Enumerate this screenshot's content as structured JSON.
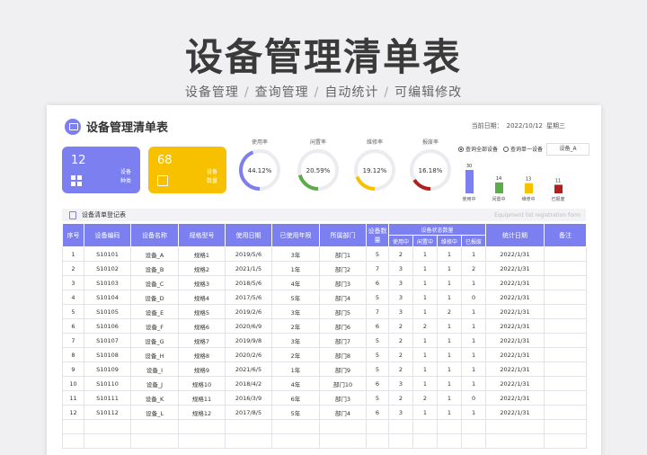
{
  "hero": {
    "title": "设备管理清单表",
    "subtitle": [
      "设备管理",
      "查询管理",
      "自动统计",
      "可编辑修改"
    ]
  },
  "sheet": {
    "title": "设备管理清单表",
    "date_label": "当前日期：",
    "date_value": "2022/10/12",
    "weekday": "星期三"
  },
  "kpis": [
    {
      "value": "12",
      "label": "设备种类",
      "color": "#7b7ff0",
      "icon": "grid-icon"
    },
    {
      "value": "68",
      "label": "设备数量",
      "color": "#f8c100",
      "icon": "calendar-icon"
    }
  ],
  "gauges": [
    {
      "label": "使用率",
      "value": "44.12%",
      "fraction": 0.4412,
      "color": "#7b7ff0"
    },
    {
      "label": "闲置率",
      "value": "20.59%",
      "fraction": 0.2059,
      "color": "#5cac4b"
    },
    {
      "label": "维修率",
      "value": "19.12%",
      "fraction": 0.1912,
      "color": "#f8c100"
    },
    {
      "label": "报废率",
      "value": "16.18%",
      "fraction": 0.1618,
      "color": "#b21f1f"
    }
  ],
  "query": {
    "options": [
      "查询全部设备",
      "查询单一设备"
    ],
    "selected": 0,
    "select_value": "设备_A"
  },
  "mini_bars": [
    {
      "label": "使用中",
      "value": 30,
      "color": "#7b7ff0"
    },
    {
      "label": "闲置中",
      "value": 14,
      "color": "#5cac4b"
    },
    {
      "label": "维修中",
      "value": 13,
      "color": "#f8c100"
    },
    {
      "label": "已报废",
      "value": 11,
      "color": "#b21f1f"
    }
  ],
  "section": {
    "title": "设备清单登记表",
    "en": "Equipment list registration form"
  },
  "table": {
    "headers": [
      "序号",
      "设备编码",
      "设备名称",
      "规格型号",
      "使用日期",
      "已使用年限",
      "所属部门",
      "设备数量",
      "设备状态数量",
      "统计日期",
      "备注"
    ],
    "status_headers": [
      "使用中",
      "闲置中",
      "维修中",
      "已报废"
    ],
    "rows": [
      [
        "1",
        "S10101",
        "设备_A",
        "规格1",
        "2019/5/6",
        "3年",
        "部门1",
        "5",
        "2",
        "1",
        "1",
        "1",
        "2022/1/31",
        ""
      ],
      [
        "2",
        "S10102",
        "设备_B",
        "规格2",
        "2021/1/5",
        "1年",
        "部门2",
        "7",
        "3",
        "1",
        "1",
        "2",
        "2022/1/31",
        ""
      ],
      [
        "3",
        "S10103",
        "设备_C",
        "规格3",
        "2018/5/6",
        "4年",
        "部门3",
        "6",
        "3",
        "1",
        "1",
        "1",
        "2022/1/31",
        ""
      ],
      [
        "4",
        "S10104",
        "设备_D",
        "规格4",
        "2017/5/6",
        "5年",
        "部门4",
        "5",
        "3",
        "1",
        "1",
        "0",
        "2022/1/31",
        ""
      ],
      [
        "5",
        "S10105",
        "设备_E",
        "规格5",
        "2019/2/6",
        "3年",
        "部门5",
        "7",
        "3",
        "1",
        "2",
        "1",
        "2022/1/31",
        ""
      ],
      [
        "6",
        "S10106",
        "设备_F",
        "规格6",
        "2020/6/9",
        "2年",
        "部门6",
        "6",
        "2",
        "2",
        "1",
        "1",
        "2022/1/31",
        ""
      ],
      [
        "7",
        "S10107",
        "设备_G",
        "规格7",
        "2019/9/8",
        "3年",
        "部门7",
        "5",
        "2",
        "1",
        "1",
        "1",
        "2022/1/31",
        ""
      ],
      [
        "8",
        "S10108",
        "设备_H",
        "规格8",
        "2020/2/6",
        "2年",
        "部门8",
        "5",
        "2",
        "1",
        "1",
        "1",
        "2022/1/31",
        ""
      ],
      [
        "9",
        "S10109",
        "设备_I",
        "规格9",
        "2021/6/5",
        "1年",
        "部门9",
        "5",
        "2",
        "1",
        "1",
        "1",
        "2022/1/31",
        ""
      ],
      [
        "10",
        "S10110",
        "设备_J",
        "规格10",
        "2018/4/2",
        "4年",
        "部门10",
        "6",
        "3",
        "1",
        "1",
        "1",
        "2022/1/31",
        ""
      ],
      [
        "11",
        "S10111",
        "设备_K",
        "规格11",
        "2016/3/9",
        "6年",
        "部门3",
        "5",
        "2",
        "2",
        "1",
        "0",
        "2022/1/31",
        ""
      ],
      [
        "12",
        "S10112",
        "设备_L",
        "规格12",
        "2017/8/5",
        "5年",
        "部门4",
        "6",
        "3",
        "1",
        "1",
        "1",
        "2022/1/31",
        ""
      ]
    ],
    "empty_rows": 2
  }
}
